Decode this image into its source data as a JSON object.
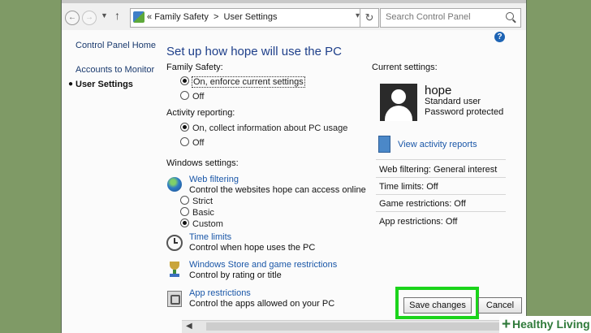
{
  "address_bar": {
    "breadcrumb_prefix": "«",
    "crumb_1": "Family Safety",
    "separator": ">",
    "crumb_2": "User Settings",
    "search_placeholder": "Search Control Panel"
  },
  "sidebar": {
    "items": [
      {
        "label": "Control Panel Home"
      },
      {
        "label": "Accounts to Monitor"
      },
      {
        "label": "User Settings",
        "current": true
      }
    ]
  },
  "main": {
    "title": "Set up how hope will use the PC",
    "family_safety": {
      "label": "Family Safety:",
      "options": [
        {
          "label": "On, enforce current settings",
          "selected": true
        },
        {
          "label": "Off",
          "selected": false
        }
      ]
    },
    "activity_reporting": {
      "label": "Activity reporting:",
      "options": [
        {
          "label": "On, collect information about PC usage",
          "selected": true
        },
        {
          "label": "Off",
          "selected": false
        }
      ]
    },
    "windows_settings": {
      "label": "Windows settings:",
      "web_filtering": {
        "link": "Web filtering",
        "desc": "Control the websites hope can access online",
        "options": [
          {
            "label": "Strict",
            "selected": false
          },
          {
            "label": "Basic",
            "selected": false
          },
          {
            "label": "Custom",
            "selected": true
          }
        ]
      },
      "time_limits": {
        "link": "Time limits",
        "desc": "Control when hope uses the PC"
      },
      "store_restrictions": {
        "link": "Windows Store and game restrictions",
        "desc": "Control by rating or title"
      },
      "app_restrictions": {
        "link": "App restrictions",
        "desc": "Control the apps allowed on your PC"
      }
    }
  },
  "current_settings": {
    "label": "Current settings:",
    "user_name": "hope",
    "user_type": "Standard user",
    "password_status": "Password protected",
    "view_reports": "View activity reports",
    "summary": [
      "Web filtering: General interest",
      "Time limits: Off",
      "Game restrictions: Off",
      "App restrictions: Off"
    ]
  },
  "buttons": {
    "save": "Save changes",
    "cancel": "Cancel"
  },
  "watermark": {
    "plus": "+",
    "text": "Healthy Living"
  },
  "colors": {
    "background": "#7f9a66",
    "link": "#1a57a8",
    "title": "#1e3f8a",
    "highlight": "#1bd41b"
  }
}
